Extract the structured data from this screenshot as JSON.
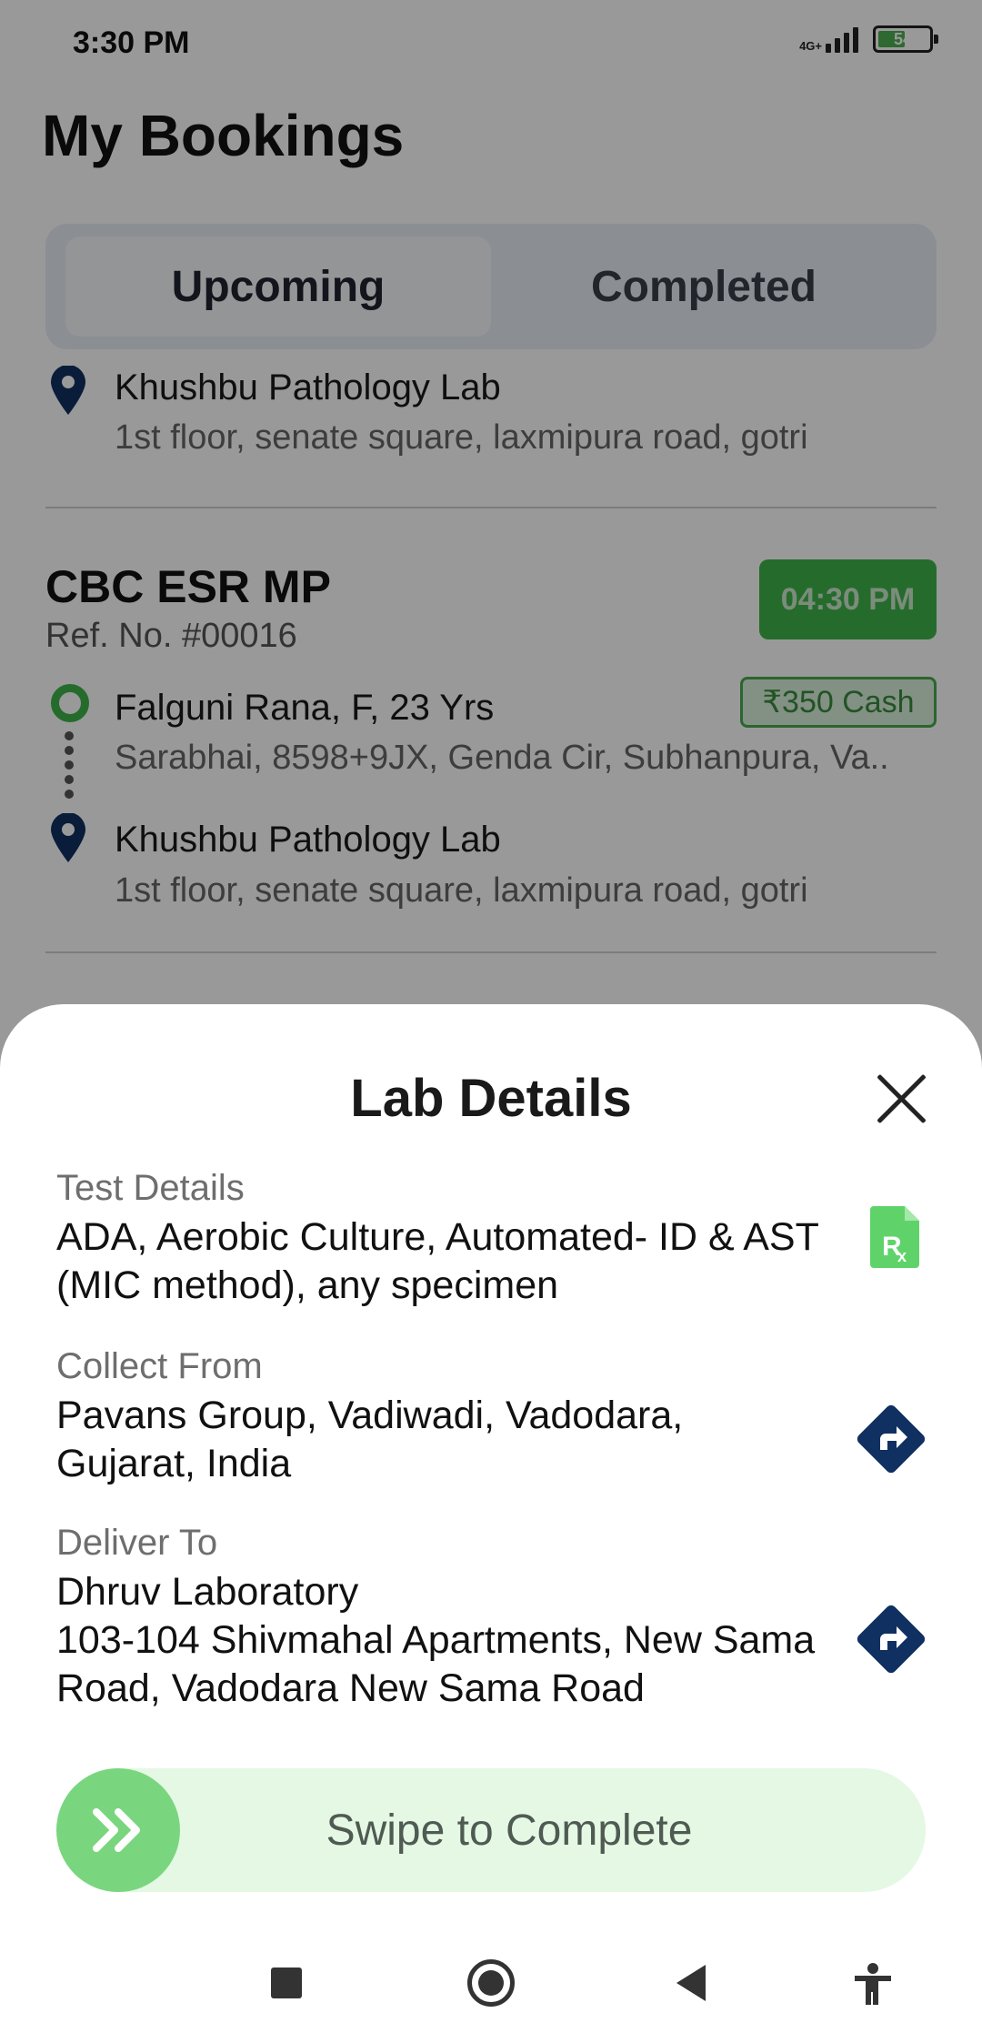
{
  "status_bar": {
    "time": "3:30 PM",
    "network": "4G+",
    "battery": "54",
    "battery_level": 0.54
  },
  "page": {
    "title": "My Bookings"
  },
  "tabs": [
    {
      "label": "Upcoming",
      "active": true
    },
    {
      "label": "Completed",
      "active": false
    }
  ],
  "bookings": [
    {
      "lab_name": "Khushbu Pathology Lab",
      "lab_address": "1st floor, senate square, laxmipura road, gotri"
    },
    {
      "test_name": "CBC ESR MP",
      "ref_no": "Ref. No. #00016",
      "time": "04:30 PM",
      "payment": "₹350 Cash",
      "patient": "Falguni Rana, F, 23 Yrs",
      "patient_address": "Sarabhai, 8598+9JX, Genda Cir, Subhanpura, Va..",
      "lab_name": "Khushbu Pathology Lab",
      "lab_address": "1st floor, senate square, laxmipura road, gotri"
    }
  ],
  "sheet": {
    "title": "Lab Details",
    "test_details_label": "Test Details",
    "test_details_value": "ADA, Aerobic Culture, Automated- ID & AST (MIC method), any specimen",
    "collect_from_label": "Collect From",
    "collect_from_value": "Pavans Group, Vadiwadi, Vadodara, Gujarat, India",
    "deliver_to_label": "Deliver To",
    "deliver_to_name": "Dhruv Laboratory",
    "deliver_to_address": "103-104 Shivmahal Apartments, New Sama Road, Vadodara New Sama Road",
    "swipe_label": "Swipe to Complete"
  },
  "icons": {
    "prescription": "prescription-file-icon",
    "directions": "directions-icon",
    "close": "close-icon",
    "swipe": "double-chevron-right-icon"
  },
  "colors": {
    "accent_green": "#3fb54a",
    "navy": "#0f3060",
    "swipe_bg": "#e4f8e4"
  }
}
